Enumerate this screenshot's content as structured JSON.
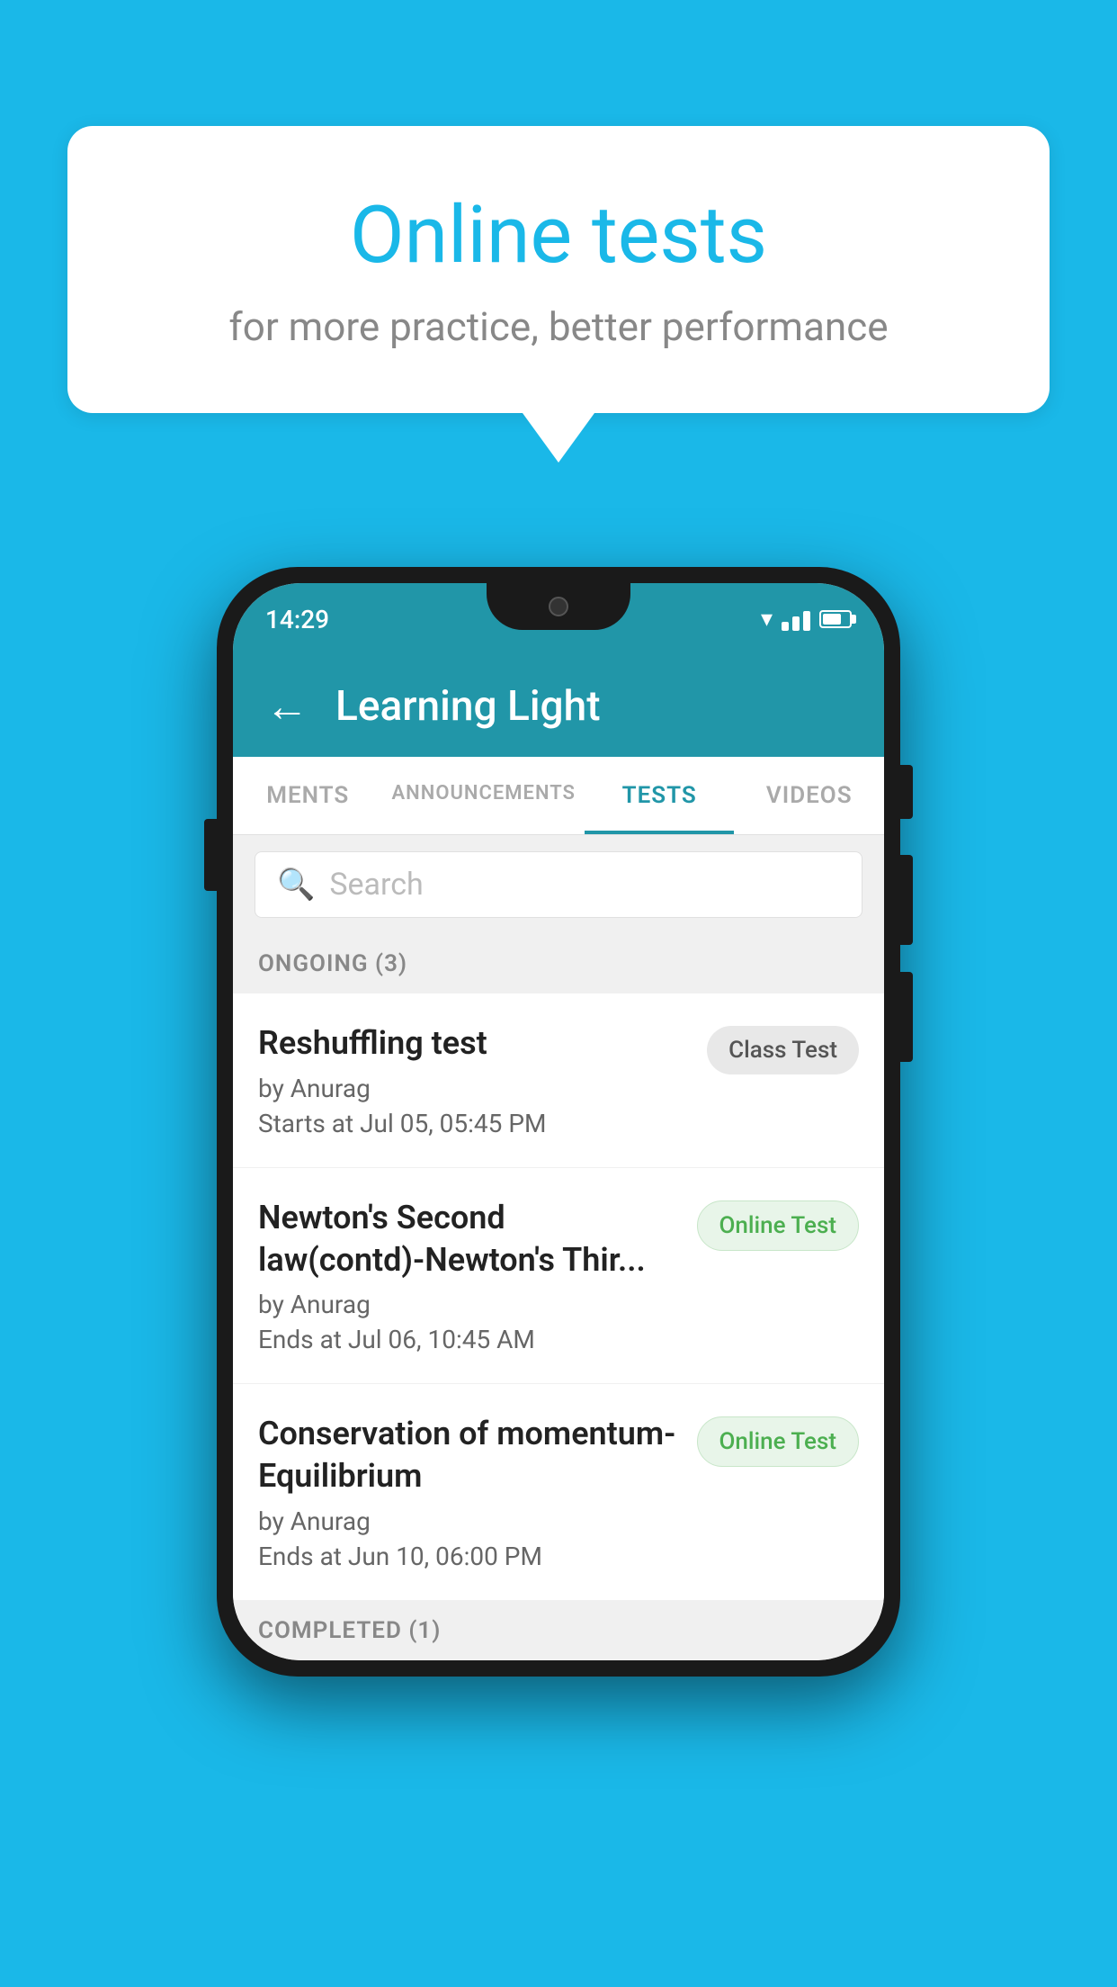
{
  "background": {
    "color": "#1ab8e8"
  },
  "speechBubble": {
    "title": "Online tests",
    "subtitle": "for more practice, better performance"
  },
  "phone": {
    "statusBar": {
      "time": "14:29"
    },
    "header": {
      "backLabel": "←",
      "title": "Learning Light"
    },
    "tabs": [
      {
        "label": "MENTS",
        "active": false
      },
      {
        "label": "ANNOUNCEMENTS",
        "active": false
      },
      {
        "label": "TESTS",
        "active": true
      },
      {
        "label": "VIDEOS",
        "active": false
      }
    ],
    "search": {
      "placeholder": "Search"
    },
    "ongoingSection": {
      "label": "ONGOING (3)"
    },
    "testItems": [
      {
        "name": "Reshuffling test",
        "author": "by Anurag",
        "time": "Starts at  Jul 05, 05:45 PM",
        "badge": "Class Test",
        "badgeType": "class"
      },
      {
        "name": "Newton's Second law(contd)-Newton's Thir...",
        "author": "by Anurag",
        "time": "Ends at  Jul 06, 10:45 AM",
        "badge": "Online Test",
        "badgeType": "online"
      },
      {
        "name": "Conservation of momentum-Equilibrium",
        "author": "by Anurag",
        "time": "Ends at  Jun 10, 06:00 PM",
        "badge": "Online Test",
        "badgeType": "online"
      }
    ],
    "completedSection": {
      "label": "COMPLETED (1)"
    }
  }
}
